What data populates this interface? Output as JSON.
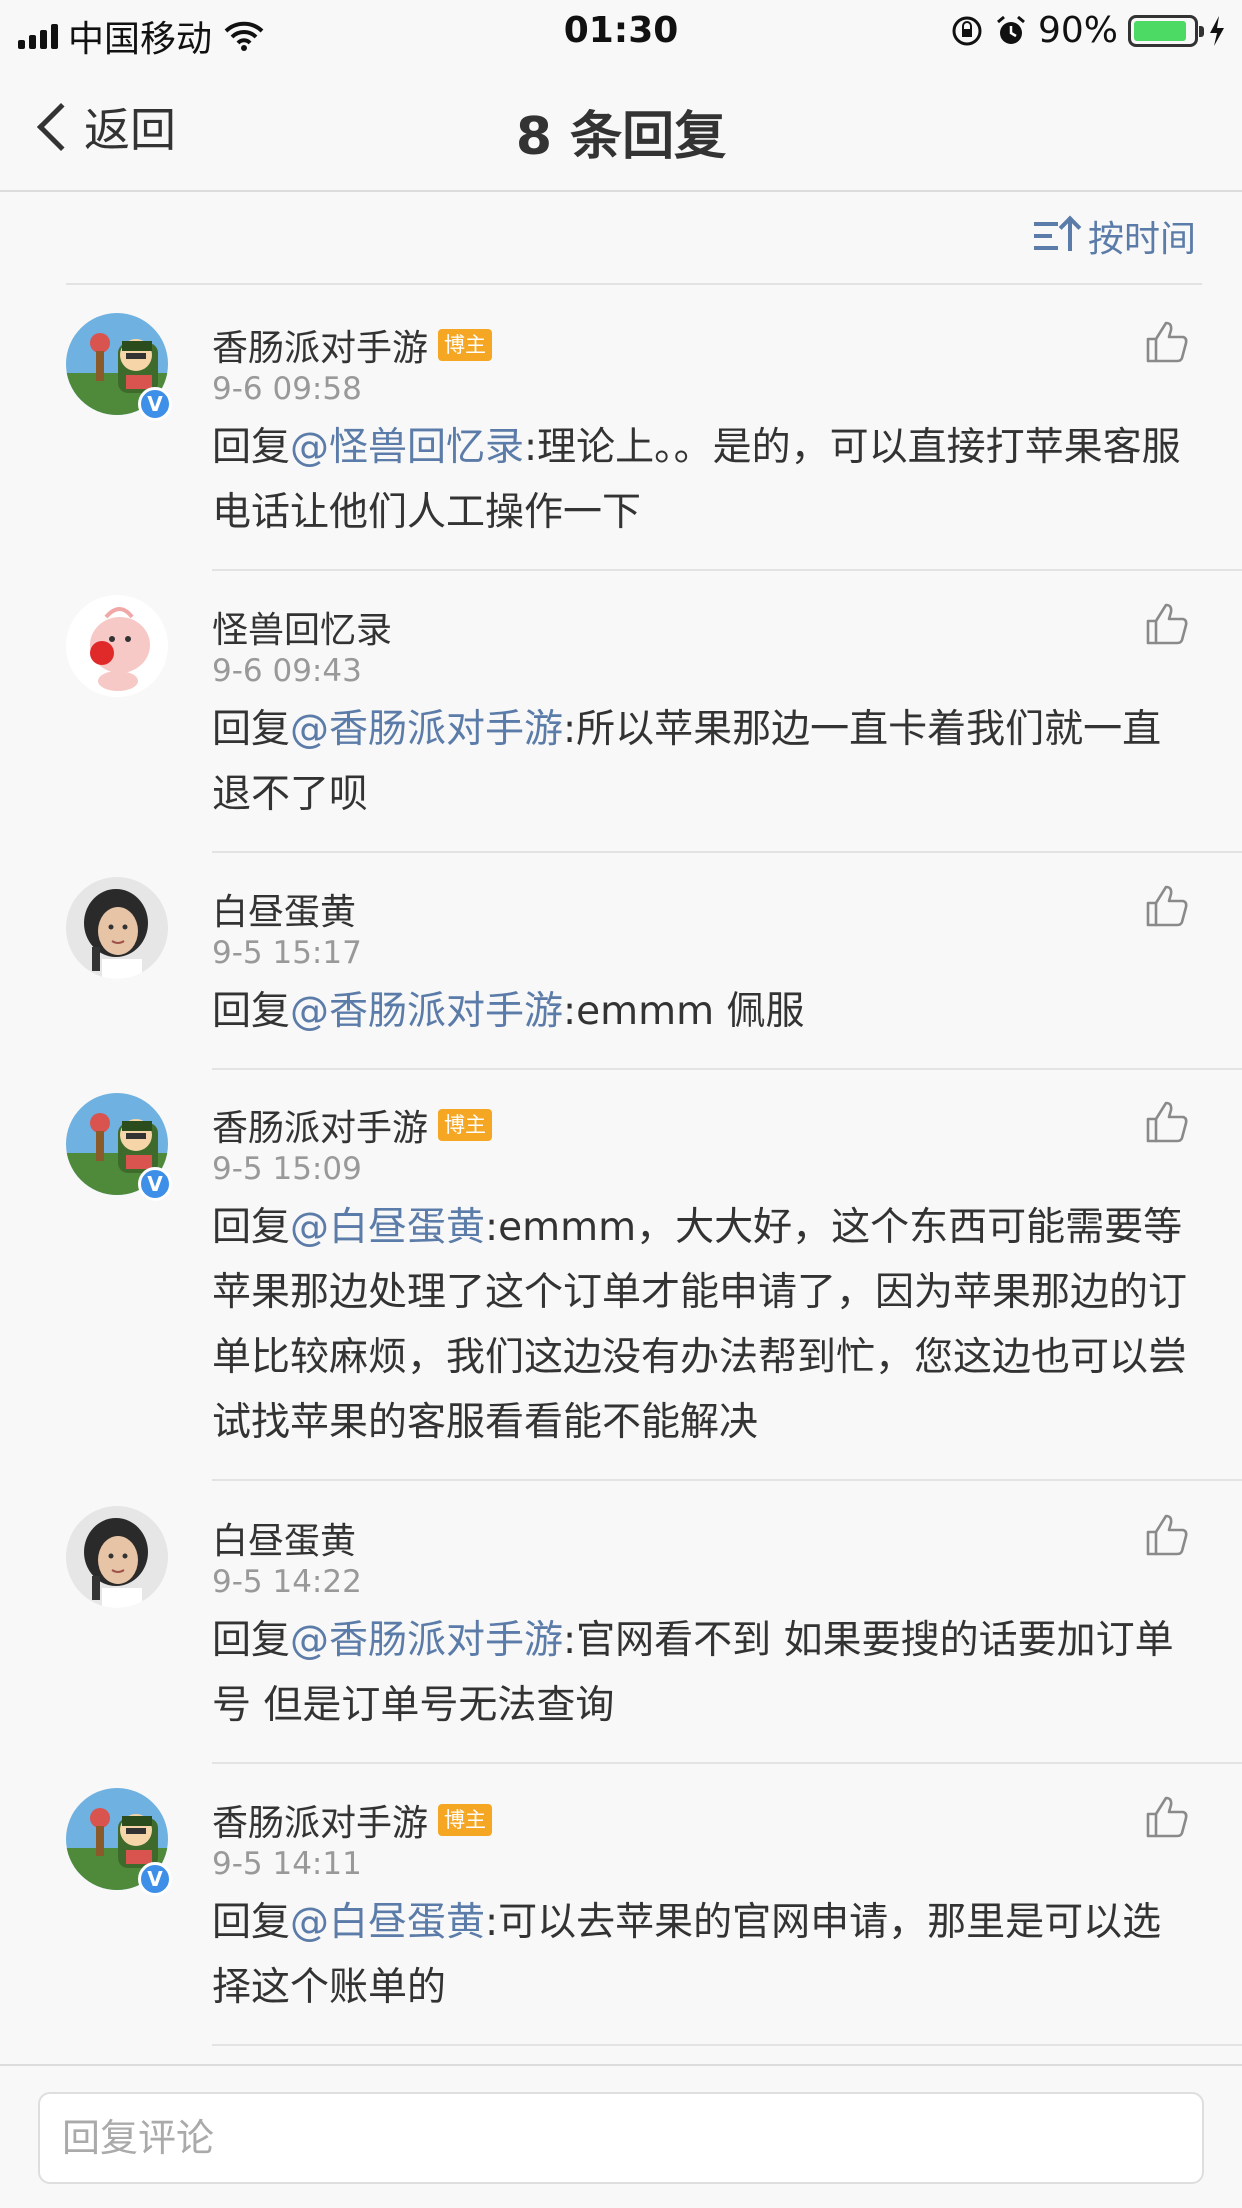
{
  "status_bar": {
    "carrier": "中国移动",
    "time": "01:30",
    "battery": "90%",
    "battery_level": 0.9
  },
  "nav": {
    "back_label": "返回",
    "title": "8 条回复"
  },
  "sort": {
    "label": "按时间"
  },
  "comments": [
    {
      "name": "香肠派对手游",
      "tag": "博主",
      "verified": true,
      "time": "9-6 09:58",
      "reply_prefix": "回复",
      "mention": "@怪兽回忆录",
      "body": ":理论上。。是的，可以直接打苹果客服电话让他们人工操作一下"
    },
    {
      "name": "怪兽回忆录",
      "tag": "",
      "verified": false,
      "time": "9-6 09:43",
      "reply_prefix": "回复",
      "mention": "@香肠派对手游",
      "body": ":所以苹果那边一直卡着我们就一直退不了呗"
    },
    {
      "name": "白昼蛋黄",
      "tag": "",
      "verified": false,
      "time": "9-5 15:17",
      "reply_prefix": "回复",
      "mention": "@香肠派对手游",
      "body": ":emmm 佩服"
    },
    {
      "name": "香肠派对手游",
      "tag": "博主",
      "verified": true,
      "time": "9-5 15:09",
      "reply_prefix": "回复",
      "mention": "@白昼蛋黄",
      "body": ":emmm，大大好，这个东西可能需要等苹果那边处理了这个订单才能申请了，因为苹果那边的订单比较麻烦，我们这边没有办法帮到忙，您这边也可以尝试找苹果的客服看看能不能解决"
    },
    {
      "name": "白昼蛋黄",
      "tag": "",
      "verified": false,
      "time": "9-5 14:22",
      "reply_prefix": "回复",
      "mention": "@香肠派对手游",
      "body": ":官网看不到 如果要搜的话要加订单号 但是订单号无法查询"
    },
    {
      "name": "香肠派对手游",
      "tag": "博主",
      "verified": true,
      "time": "9-5 14:11",
      "reply_prefix": "回复",
      "mention": "@白昼蛋黄",
      "body": ":可以去苹果的官网申请，那里是可以选择这个账单的"
    }
  ],
  "reply_bar": {
    "placeholder": "回复评论"
  },
  "colors": {
    "link": "#5b7ba8",
    "tag": "#f5a623",
    "verified": "#3e8fe8",
    "battery": "#4cd964"
  }
}
